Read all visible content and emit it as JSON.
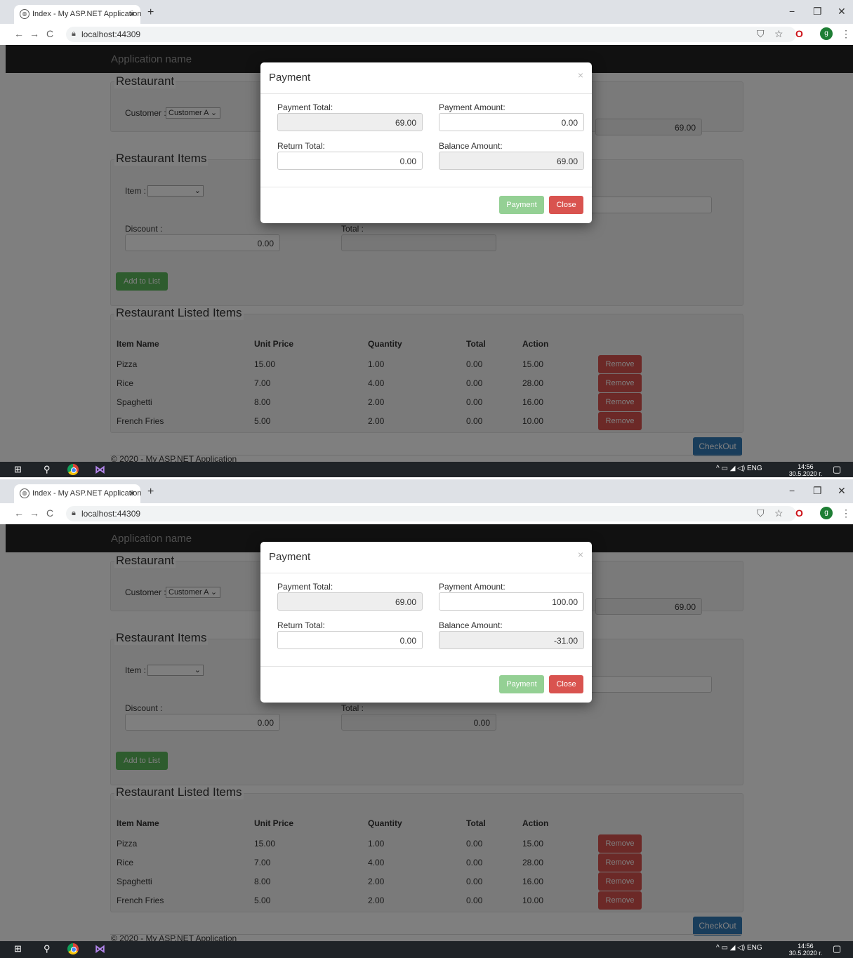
{
  "browser": {
    "tab_title": "Index - My ASP.NET Application",
    "tab_close": "×",
    "new_tab": "+",
    "url": "localhost:44309",
    "back": "←",
    "forward": "→",
    "reload": "C",
    "star": "☆",
    "opera": "O",
    "avatar_letter": "g",
    "menu": "⋮",
    "translate": "⛉",
    "minimize": "−",
    "restore": "❐",
    "close": "✕"
  },
  "app": {
    "brand": "Application name",
    "restaurant_title": "Restaurant",
    "customer_label": "Customer :",
    "customer_value": "Customer A",
    "grand_total_value": "69.00",
    "items_title": "Restaurant Items",
    "item_label": "Item :",
    "discount_label": "Discount :",
    "discount_value": "0.00",
    "total_label": "Total :",
    "add_to_list": "Add to List",
    "listed_title": "Restaurant Listed Items",
    "columns": [
      "Item Name",
      "Unit Price",
      "Quantity",
      "Total",
      "Action"
    ],
    "rows": [
      {
        "name": "Pizza",
        "unit_price": "15.00",
        "quantity": "1.00",
        "total": "0.00",
        "action": "15.00",
        "remove": "Remove"
      },
      {
        "name": "Rice",
        "unit_price": "7.00",
        "quantity": "4.00",
        "total": "0.00",
        "action": "28.00",
        "remove": "Remove"
      },
      {
        "name": "Spaghetti",
        "unit_price": "8.00",
        "quantity": "2.00",
        "total": "0.00",
        "action": "16.00",
        "remove": "Remove"
      },
      {
        "name": "French Fries",
        "unit_price": "5.00",
        "quantity": "2.00",
        "total": "0.00",
        "action": "10.00",
        "remove": "Remove"
      }
    ],
    "checkout": "CheckOut",
    "footer": "© 2020 - My ASP.NET Application"
  },
  "frames": [
    {
      "total_value": "",
      "modal": {
        "title": "Payment",
        "close_x": "×",
        "payment_total_label": "Payment Total:",
        "payment_total_value": "69.00",
        "payment_amount_label": "Payment Amount:",
        "payment_amount_value": "0.00",
        "return_total_label": "Return Total:",
        "return_total_value": "0.00",
        "balance_amount_label": "Balance Amount:",
        "balance_amount_value": "69.00",
        "payment_button": "Payment",
        "close_button": "Close"
      }
    },
    {
      "total_value": "0.00",
      "modal": {
        "title": "Payment",
        "close_x": "×",
        "payment_total_label": "Payment Total:",
        "payment_total_value": "69.00",
        "payment_amount_label": "Payment Amount:",
        "payment_amount_value": "100.00",
        "return_total_label": "Return Total:",
        "return_total_value": "0.00",
        "balance_amount_label": "Balance Amount:",
        "balance_amount_value": "-31.00",
        "payment_button": "Payment",
        "close_button": "Close"
      }
    }
  ],
  "taskbar": {
    "start": "⊞",
    "search": "⚲",
    "tray": "^ ▭ ◢ ◁) ENG",
    "time": "14:56",
    "date": "30.5.2020 г.",
    "notifications": "▢"
  }
}
